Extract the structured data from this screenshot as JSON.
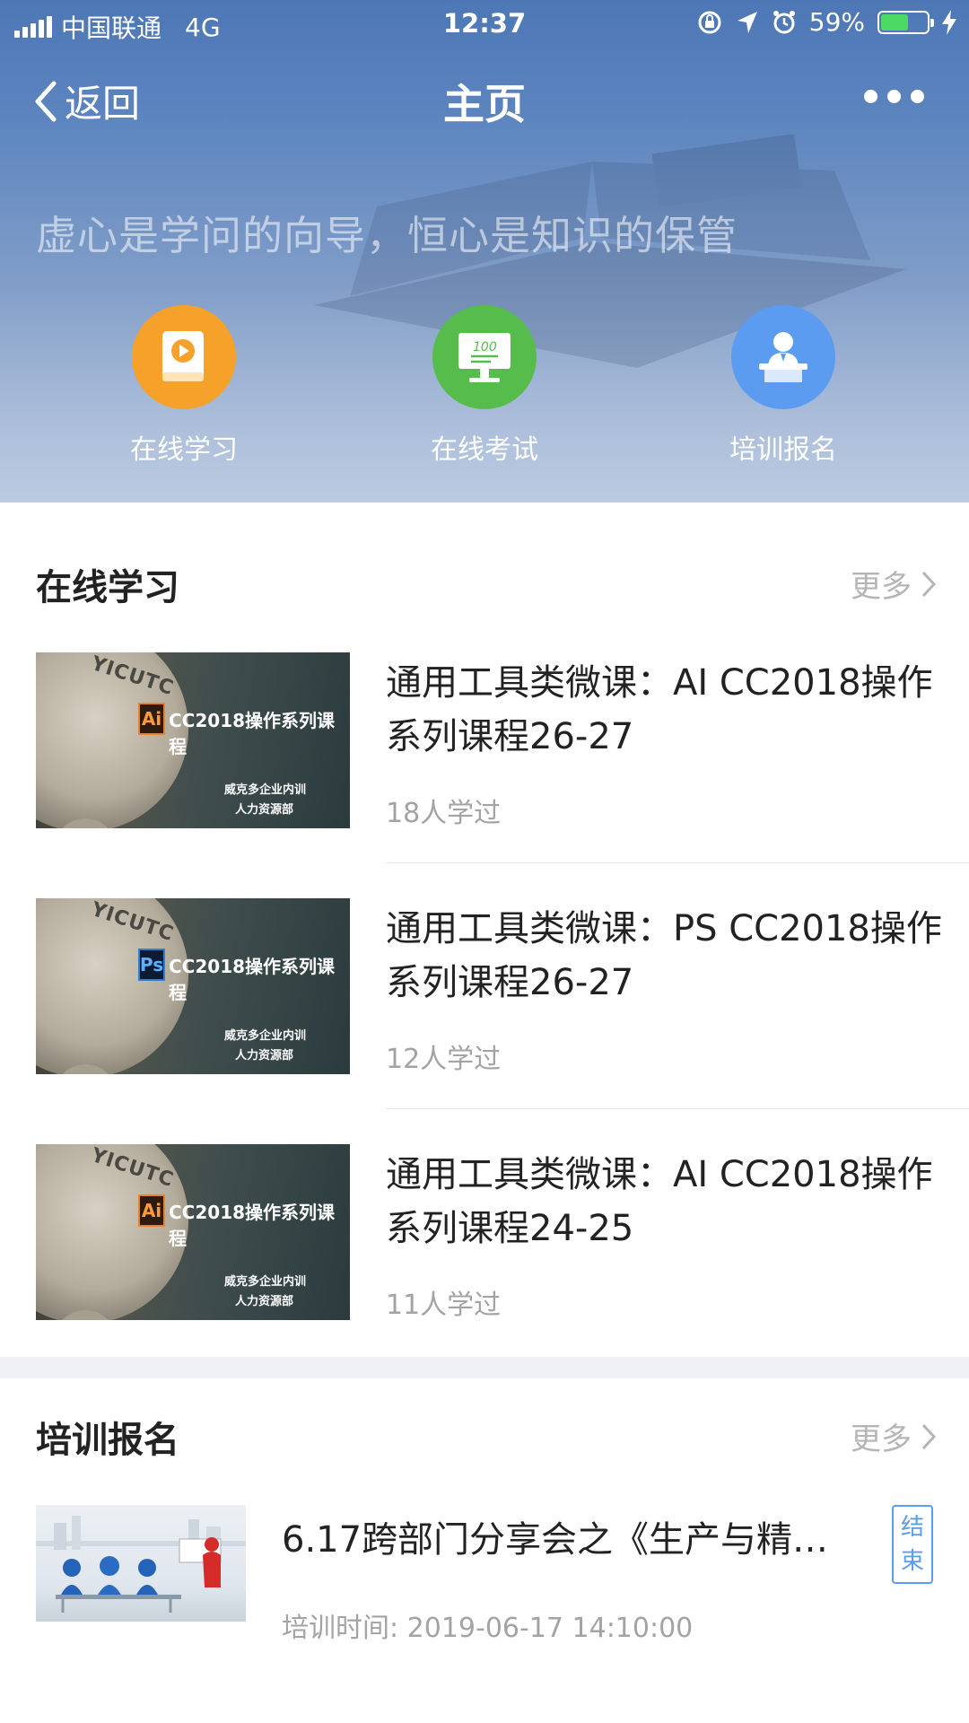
{
  "status_bar": {
    "carrier": "中国联通",
    "network": "4G",
    "time": "12:37",
    "battery_percent": "59%",
    "battery_level": 0.59
  },
  "navbar": {
    "back_label": "返回",
    "title": "主页"
  },
  "banner": {
    "slogan": "虚心是学问的向导，恒心是知识的保管"
  },
  "quick_actions": [
    {
      "label": "在线学习",
      "icon": "book-play-icon",
      "color": "#f6a22a"
    },
    {
      "label": "在线考试",
      "icon": "exam-monitor-icon",
      "color": "#56bd4d"
    },
    {
      "label": "培训报名",
      "icon": "speaker-podium-icon",
      "color": "#5b9cf0"
    }
  ],
  "online_learning": {
    "title": "在线学习",
    "more": "更多",
    "courses": [
      {
        "title": "通用工具类微课：AI CC2018操作系列课程26-27",
        "meta": "18人学过",
        "thumb_brand": "YICUTC",
        "thumb_badge": "Ai",
        "thumb_title": "CC2018操作系列课程",
        "thumb_sub1": "威克多企业内训",
        "thumb_sub2": "人力资源部"
      },
      {
        "title": "通用工具类微课：PS CC2018操作系列课程26-27",
        "meta": "12人学过",
        "thumb_brand": "YICUTC",
        "thumb_badge": "Ps",
        "thumb_title": "CC2018操作系列课程",
        "thumb_sub1": "威克多企业内训",
        "thumb_sub2": "人力资源部"
      },
      {
        "title": "通用工具类微课：AI CC2018操作系列课程24-25",
        "meta": "11人学过",
        "thumb_brand": "YICUTC",
        "thumb_badge": "Ai",
        "thumb_title": "CC2018操作系列课程",
        "thumb_sub1": "威克多企业内训",
        "thumb_sub2": "人力资源部"
      }
    ]
  },
  "training_signup": {
    "title": "培训报名",
    "more": "更多",
    "items": [
      {
        "title": "6.17跨部门分享会之《生产与精…",
        "meta": "培训时间: 2019-06-17 14:10:00",
        "status": "结束"
      }
    ]
  }
}
